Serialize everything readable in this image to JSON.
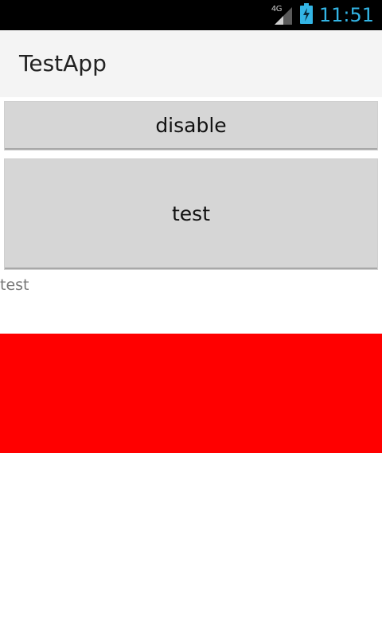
{
  "status_bar": {
    "network_type": "4G",
    "time": "11:51",
    "icons": [
      "signal-icon",
      "battery-charging-icon"
    ],
    "clock_color": "#33b5e5"
  },
  "action_bar": {
    "title": "TestApp"
  },
  "buttons": {
    "disable_label": "disable",
    "test_label": "test"
  },
  "content": {
    "text": "test",
    "block_color": "#ff0000"
  }
}
